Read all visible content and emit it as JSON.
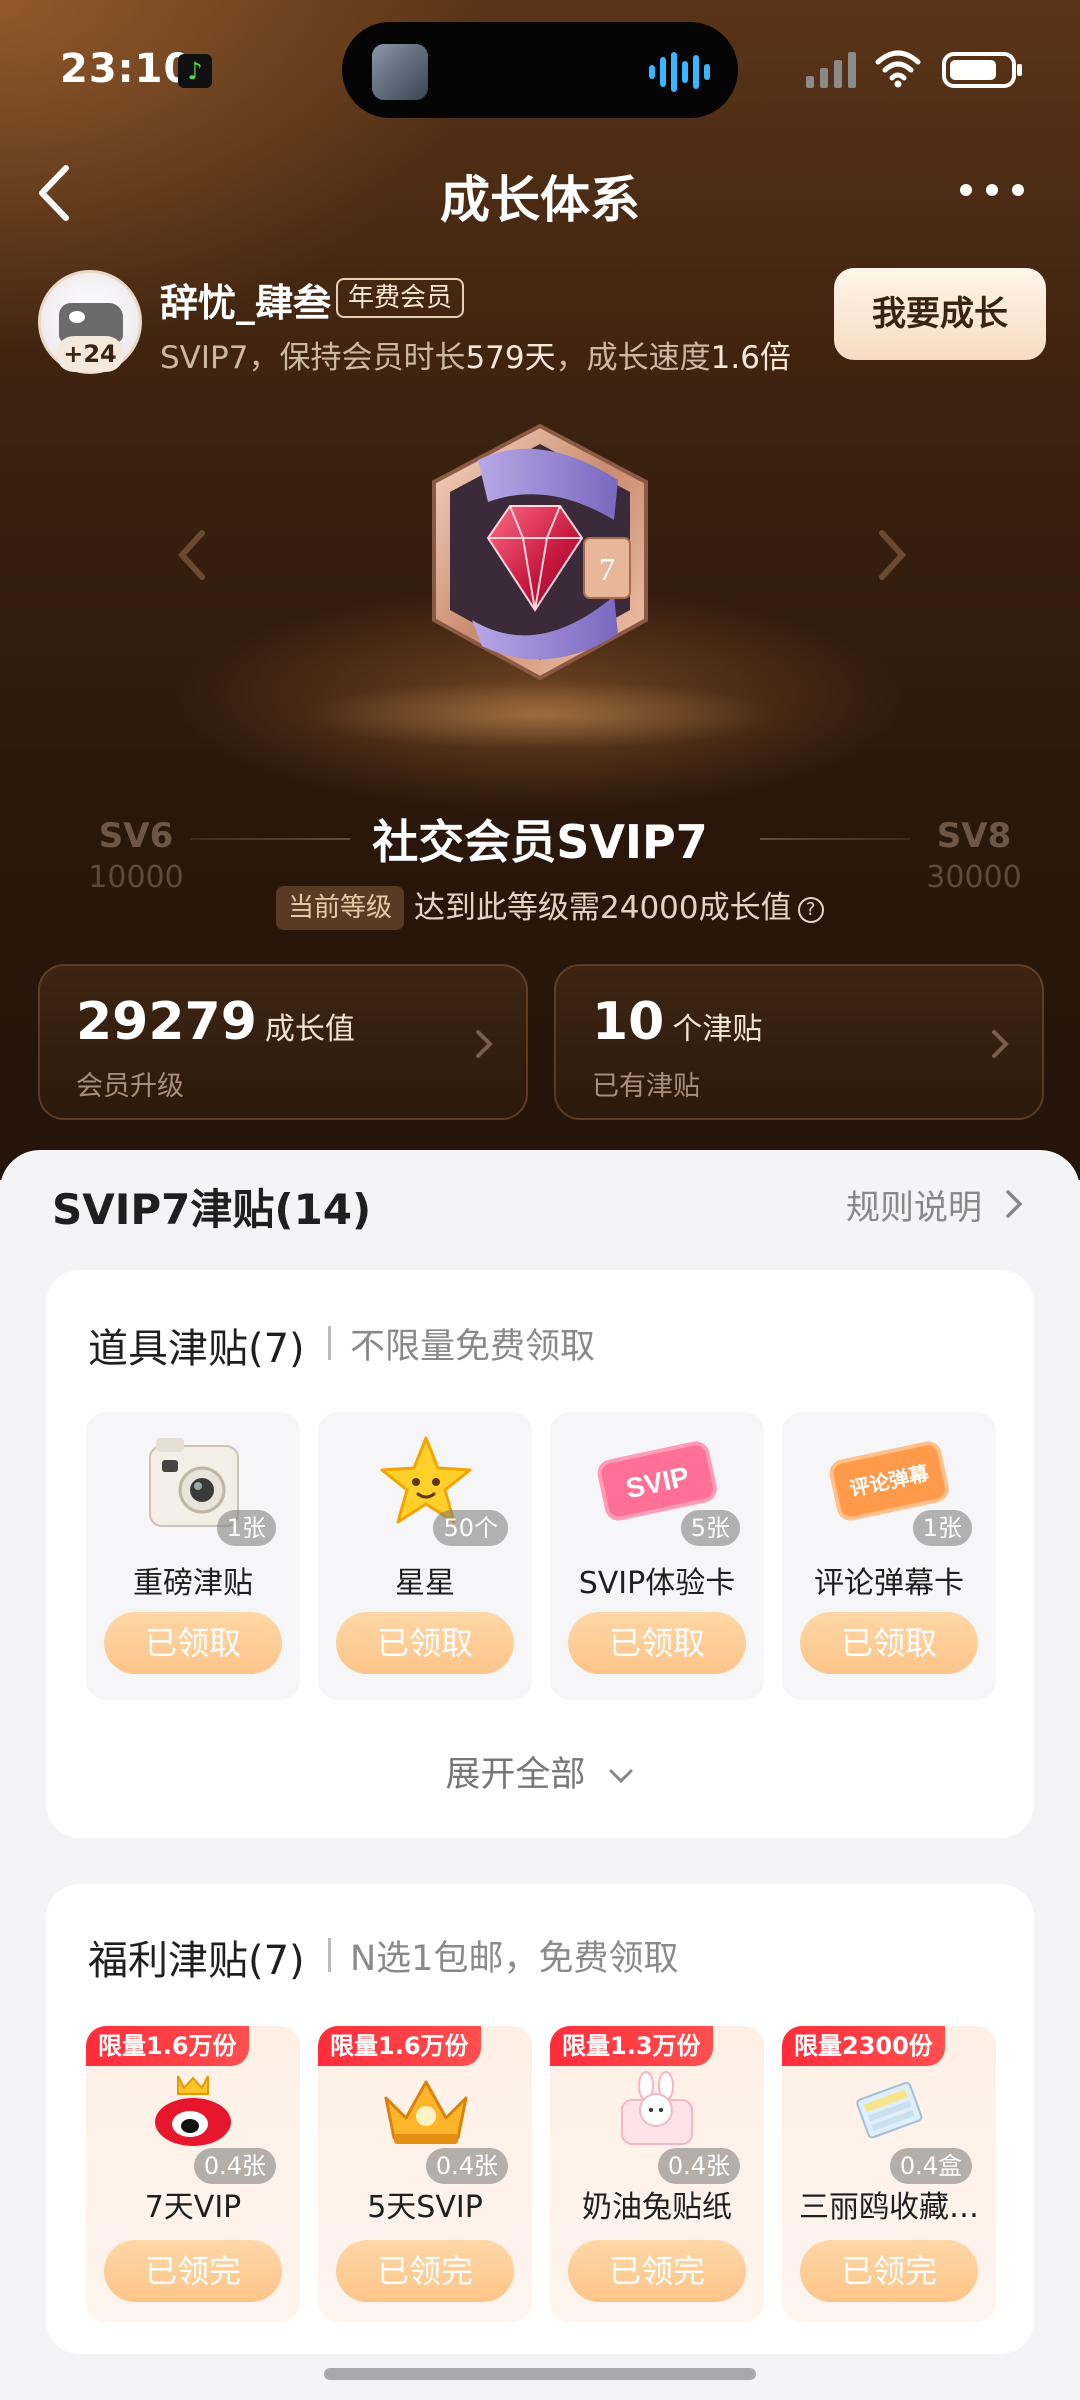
{
  "status_bar": {
    "time": "23:10"
  },
  "nav": {
    "title": "成长体系"
  },
  "user": {
    "name": "辞忧_肆叁",
    "member_tag": "年费会员",
    "avatar_badge": "+24",
    "subtitle_prefix": "SVIP7，保持会员时长",
    "days": "579天",
    "subtitle_mid": "，成长速度",
    "speed": "1.6倍",
    "grow_button": "我要成长"
  },
  "level": {
    "prev_name": "SV6",
    "prev_value": "10000",
    "next_name": "SV8",
    "next_value": "30000",
    "title": "社交会员SVIP7",
    "badge_number": "7",
    "current_tag": "当前等级",
    "requirement": "达到此等级需24000成长值"
  },
  "stats": {
    "growth_value": "29279",
    "growth_unit": "成长值",
    "growth_sub": "会员升级",
    "allowance_value": "10",
    "allowance_unit": "个津贴",
    "allowance_sub": "已有津贴"
  },
  "section": {
    "title": "SVIP7津贴(14)",
    "rules": "规则说明"
  },
  "props_card": {
    "title": "道具津贴(7)",
    "subtitle": "不限量免费领取",
    "expand": "展开全部",
    "items": [
      {
        "name": "重磅津贴",
        "count": "1张",
        "button": "已领取",
        "icon": "camera-icon"
      },
      {
        "name": "星星",
        "count": "50个",
        "button": "已领取",
        "icon": "star-icon"
      },
      {
        "name": "SVIP体验卡",
        "count": "5张",
        "button": "已领取",
        "icon": "svip-card-icon"
      },
      {
        "name": "评论弹幕卡",
        "count": "1张",
        "button": "已领取",
        "icon": "comment-card-icon",
        "icon_text": "评论弹幕"
      }
    ]
  },
  "welfare_card": {
    "title": "福利津贴(7)",
    "subtitle": "N选1包邮，免费领取",
    "items": [
      {
        "limit": "限量1.6万份",
        "name": "7天VIP",
        "count": "0.4张",
        "button": "已领完",
        "icon": "weibo-crown-icon"
      },
      {
        "limit": "限量1.6万份",
        "name": "5天SVIP",
        "count": "0.4张",
        "button": "已领完",
        "icon": "gold-crown-icon"
      },
      {
        "limit": "限量1.3万份",
        "name": "奶油兔贴纸",
        "count": "0.4张",
        "button": "已领完",
        "icon": "bunny-sticker-icon"
      },
      {
        "limit": "限量2300份",
        "name": "三丽鸥收藏…",
        "count": "0.4盒",
        "button": "已领完",
        "icon": "collection-box-icon"
      }
    ]
  },
  "colors": {
    "accent": "#fcc58a",
    "limit_red": "#ff2d3a",
    "hero_dark": "#2a170b"
  }
}
